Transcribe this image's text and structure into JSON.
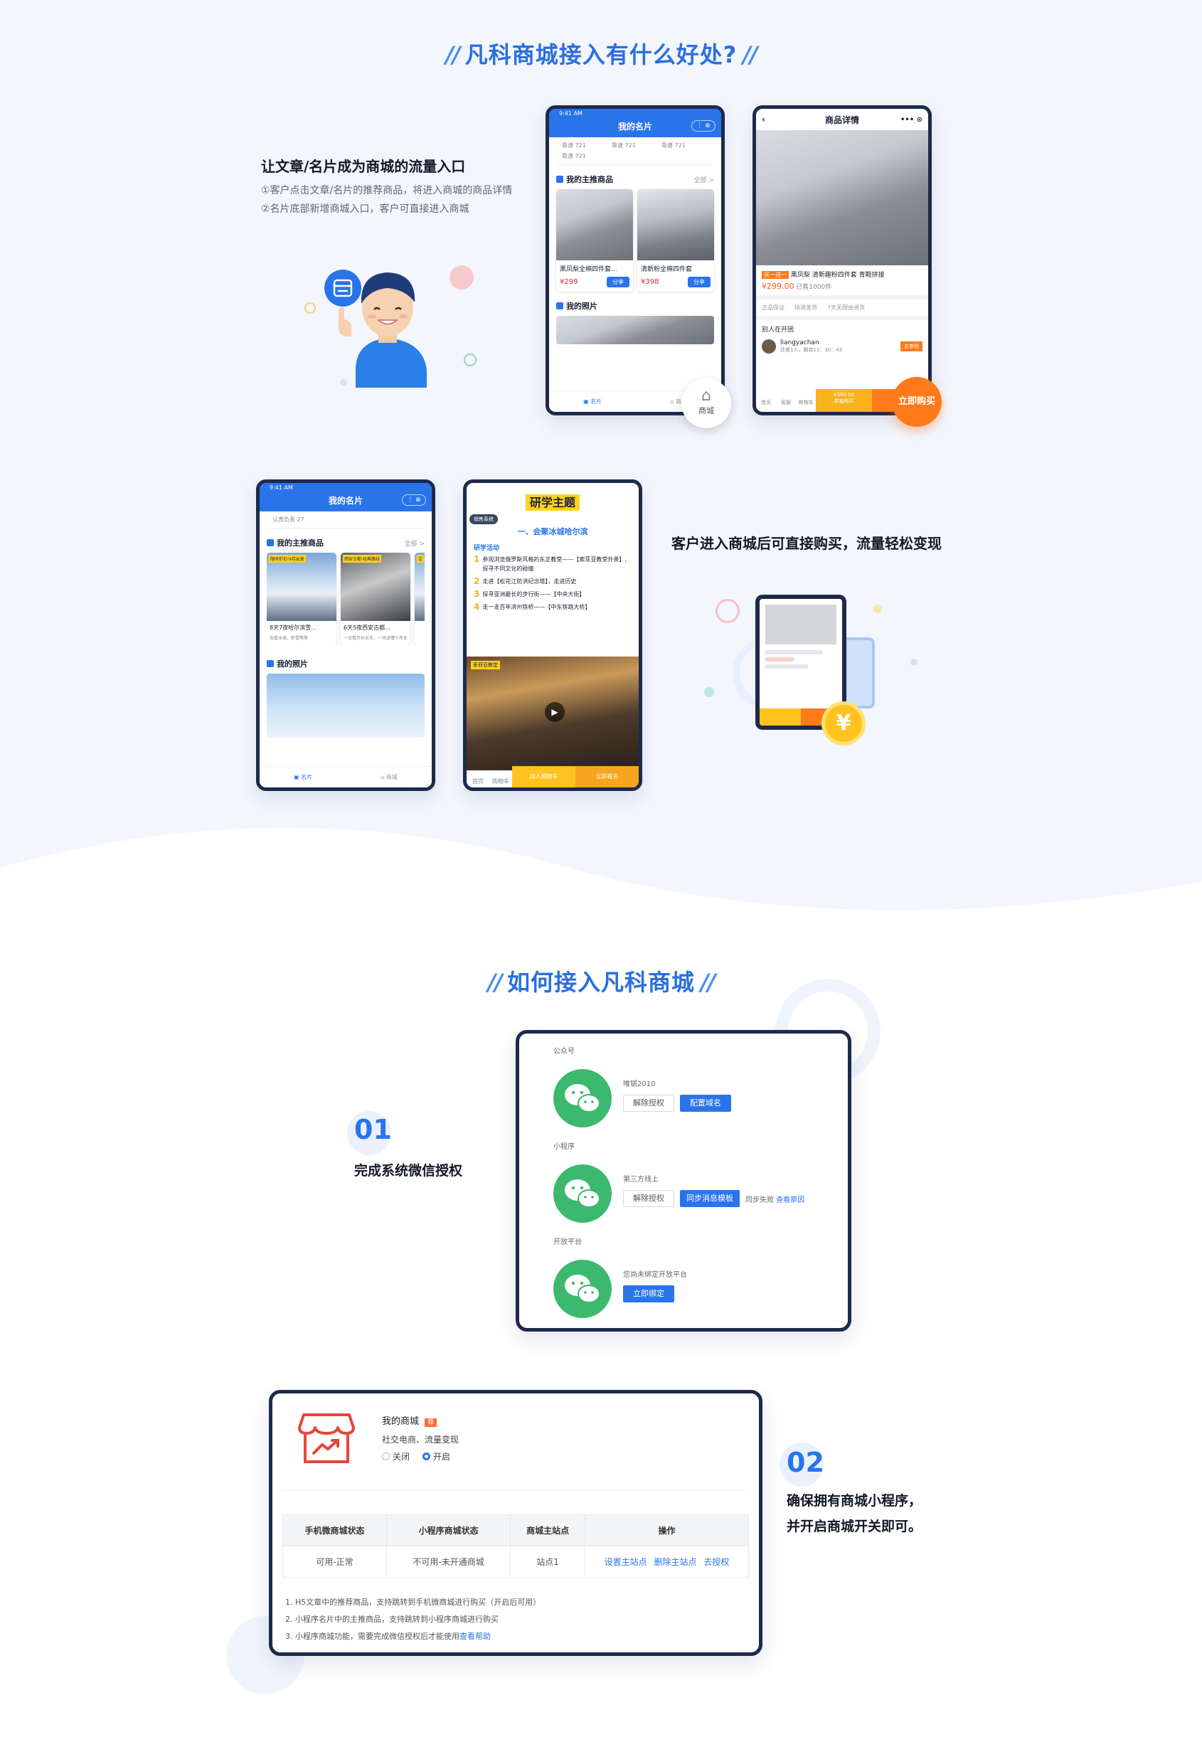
{
  "section1": {
    "title": "凡科商城接入有什么好处?",
    "feature1": {
      "title": "让文章/名片成为商城的流量入口",
      "lines": [
        "①客户点击文章/名片的推荐商品，将进入商城的商品详情",
        "②名片底部新增商城入口，客户可直接进入商城"
      ]
    },
    "feature2": {
      "title": "客户进入商城后可直接购买，流量轻松变现"
    },
    "phone_card": {
      "status": "9:41 AM",
      "title": "我的名片",
      "likes": [
        "靠谱 721",
        "靠谱 721",
        "靠谱 721",
        "靠谱 721"
      ],
      "section_products": "我的主推商品",
      "more": "全部 >",
      "products": [
        {
          "name": "黑凤梨全棉四件套...",
          "price": "¥299",
          "share": "分享"
        },
        {
          "name": "清新粉全棉四件套",
          "price": "¥398",
          "share": "分享"
        }
      ],
      "section_photos": "我的照片",
      "tab_card": "名片",
      "tab_mall": "商城",
      "mall_badge": "商城"
    },
    "phone_detail": {
      "title": "商品详情",
      "tag": "买一送一",
      "product_name": "黑凤梨 清新趣粉四件套 青鞋拼接",
      "price": "¥299.00",
      "sold": "已售1000件",
      "guarantees": [
        "正品保证",
        "快递发货",
        "7天无理由退货"
      ],
      "group_title": "别人在开团",
      "group_user": "liangyachan",
      "group_hint": "还差1人，剩余11：30：43",
      "group_btn": "去参团",
      "tabs": [
        "首页",
        "客服",
        "购物车"
      ],
      "buy_price": "¥388.00",
      "buy_label": "单独购买",
      "buy_now": "立即购买"
    },
    "phone_card2": {
      "status": "9:41 AM",
      "title": "我的名片",
      "likes": "认真负责 27",
      "section_products": "我的主推商品",
      "more": "全部 >",
      "items": [
        {
          "tag": "限时折扣·9月出发",
          "name": "8天7夜哈尔滨雪...",
          "desc": "去看冰城、聆雪等等"
        },
        {
          "tag": "西安古都·经典路线",
          "name": "6天5夜西安古都...",
          "desc": "一日看尽长安花，一场读懂千年史"
        },
        {
          "tag": "立"
        }
      ],
      "section_photos": "我的照片",
      "tab_card": "名片",
      "tab_mall": "商城"
    },
    "phone_article": {
      "header": "研学主题",
      "badge": "销售系统",
      "subtitle": "一、会聚冰城哈尔滨",
      "section": "研学活动",
      "list": [
        "参观浏览俄罗斯风格的东正教堂——【索菲亚教堂外景】,探寻不同文化的碰撞",
        "走进【松花江防洪纪念塔】，走进历史",
        "探寻亚洲最长的步行街——【中央大街】",
        "走一走百年滨州铁桥——【中东铁路大桥】"
      ],
      "video_tag": "索菲亚教堂",
      "tabs": [
        "首页",
        "购物车"
      ],
      "cart_btn": "加入购物车",
      "buy_btn": "立即报名"
    },
    "tablet_coin": "¥"
  },
  "section2": {
    "title": "如何接入凡科商城",
    "step1": {
      "num": "01",
      "label": "完成系统微信授权"
    },
    "auth_panel": {
      "blocks": [
        {
          "heading": "公众号",
          "account": "唯锅2010",
          "buttons": [
            "解除授权",
            "配置域名"
          ]
        },
        {
          "heading": "小程序",
          "account": "第三方线上",
          "buttons": [
            "解除授权",
            "同步消息模板"
          ],
          "status": "同步失败",
          "link": "查看原因"
        },
        {
          "heading": "开放平台",
          "account": "您尚未绑定开放平台",
          "buttons": [
            "立即绑定"
          ]
        }
      ]
    },
    "step2": {
      "num": "02",
      "lines": [
        "确保拥有商城小程序，",
        "并开启商城开关即可。"
      ]
    },
    "mall_panel": {
      "name": "我的商城",
      "badge": "荐",
      "desc": "社交电商、流量变现",
      "radio_off": "关闭",
      "radio_on": "开启",
      "headers": [
        "手机微商城状态",
        "小程序商城状态",
        "商城主站点",
        "操作"
      ],
      "row": [
        "可用-正常",
        "不可用-未开通商城",
        "站点1"
      ],
      "ops": [
        "设置主站点",
        "删除主站点",
        "去授权"
      ],
      "notes": [
        "1. H5文章中的推荐商品，支持跳转到手机微商城进行购买（开启后可用）",
        "2. 小程序名片中的主推商品，支持跳转到小程序商城进行购买",
        "3. 小程序商城功能，需要完成微信授权后才能使用"
      ],
      "help_link": "查看帮助"
    }
  },
  "colors": {
    "brand": "#2a74ea",
    "dark_frame": "#1e2a4a",
    "orange": "#ff7a1a",
    "wechat": "#3cb96e"
  }
}
